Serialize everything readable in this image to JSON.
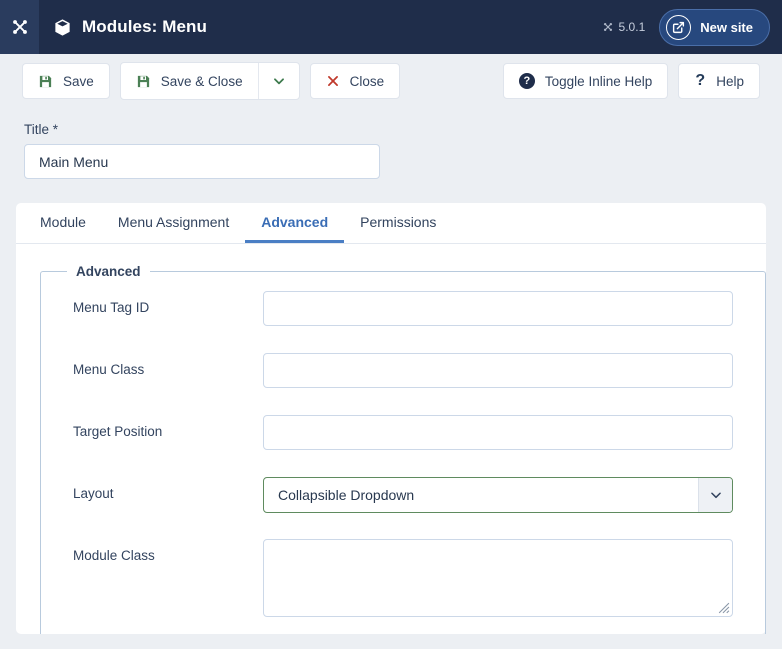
{
  "header": {
    "brand_icon": "joomla-logo-icon",
    "page_icon": "cube-icon",
    "title": "Modules: Menu",
    "version_label": "5.0.1",
    "version_icon": "joomla-mini-icon",
    "new_site_label": "New site",
    "new_site_icon": "external-link-icon",
    "bg_color": "#1f2d4a",
    "accent_color": "#27487e"
  },
  "toolbar": {
    "save_label": "Save",
    "save_icon": "floppy-disk-icon",
    "save_close_label": "Save & Close",
    "save_close_icon": "floppy-disk-icon",
    "dropdown_icon": "chevron-down-icon",
    "close_label": "Close",
    "close_icon": "x-icon",
    "toggle_inline_help_label": "Toggle Inline Help",
    "toggle_inline_help_icon": "question-circle-icon",
    "help_label": "Help",
    "help_icon": "question-mark-icon",
    "save_icon_color": "#4b8055",
    "close_icon_color": "#c0392b"
  },
  "title_field": {
    "label": "Title *",
    "value": "Main Menu",
    "placeholder": ""
  },
  "tabs": [
    {
      "label": "Module",
      "active": false
    },
    {
      "label": "Menu Assignment",
      "active": false
    },
    {
      "label": "Advanced",
      "active": true
    },
    {
      "label": "Permissions",
      "active": false
    }
  ],
  "fieldset": {
    "legend": "Advanced",
    "fields": [
      {
        "label": "Menu Tag ID",
        "type": "text",
        "value": "",
        "placeholder": ""
      },
      {
        "label": "Menu Class",
        "type": "text",
        "value": "",
        "placeholder": ""
      },
      {
        "label": "Target Position",
        "type": "text",
        "value": "",
        "placeholder": ""
      },
      {
        "label": "Layout",
        "type": "select",
        "value": "Collapsible Dropdown",
        "options": [
          "Collapsible Dropdown"
        ]
      },
      {
        "label": "Module Class",
        "type": "textarea",
        "value": "",
        "placeholder": ""
      }
    ]
  }
}
